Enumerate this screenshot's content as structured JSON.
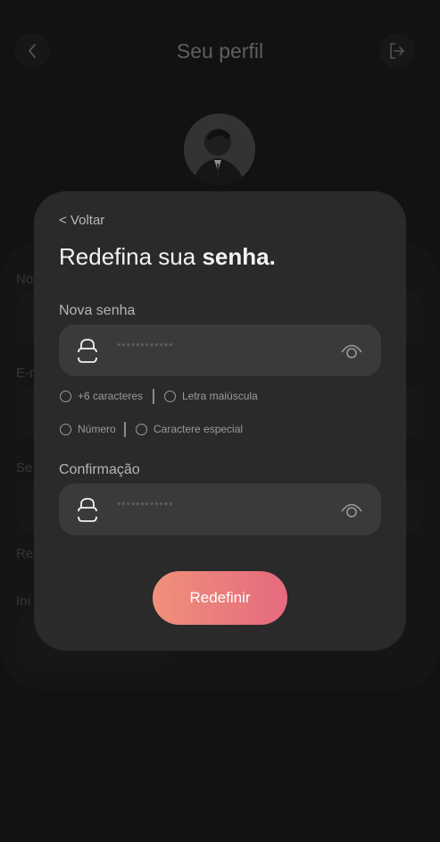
{
  "header": {
    "title": "Seu perfil"
  },
  "background_labels": [
    "No",
    "E-n",
    "Se",
    "Re",
    "Iní"
  ],
  "modal": {
    "back_label": "< Voltar",
    "title_regular": "Redefina sua ",
    "title_bold": "senha.",
    "new_password": {
      "label": "Nova senha",
      "masked_value": "************"
    },
    "rules": {
      "min_chars": "+6 caracteres",
      "uppercase": "Letra maiúscula",
      "number": "Número",
      "special": "Caractere especial"
    },
    "confirm_password": {
      "label": "Confirmação",
      "masked_value": "************"
    },
    "submit_label": "Redefinir"
  },
  "colors": {
    "background": "#171717",
    "modal": "#2a2a2a",
    "input": "#3a3a3a",
    "button_gradient_start": "#f0907a",
    "button_gradient_end": "#e56a7e"
  },
  "icons": [
    "back-icon",
    "logout-icon",
    "lock-icon",
    "eye-icon"
  ]
}
